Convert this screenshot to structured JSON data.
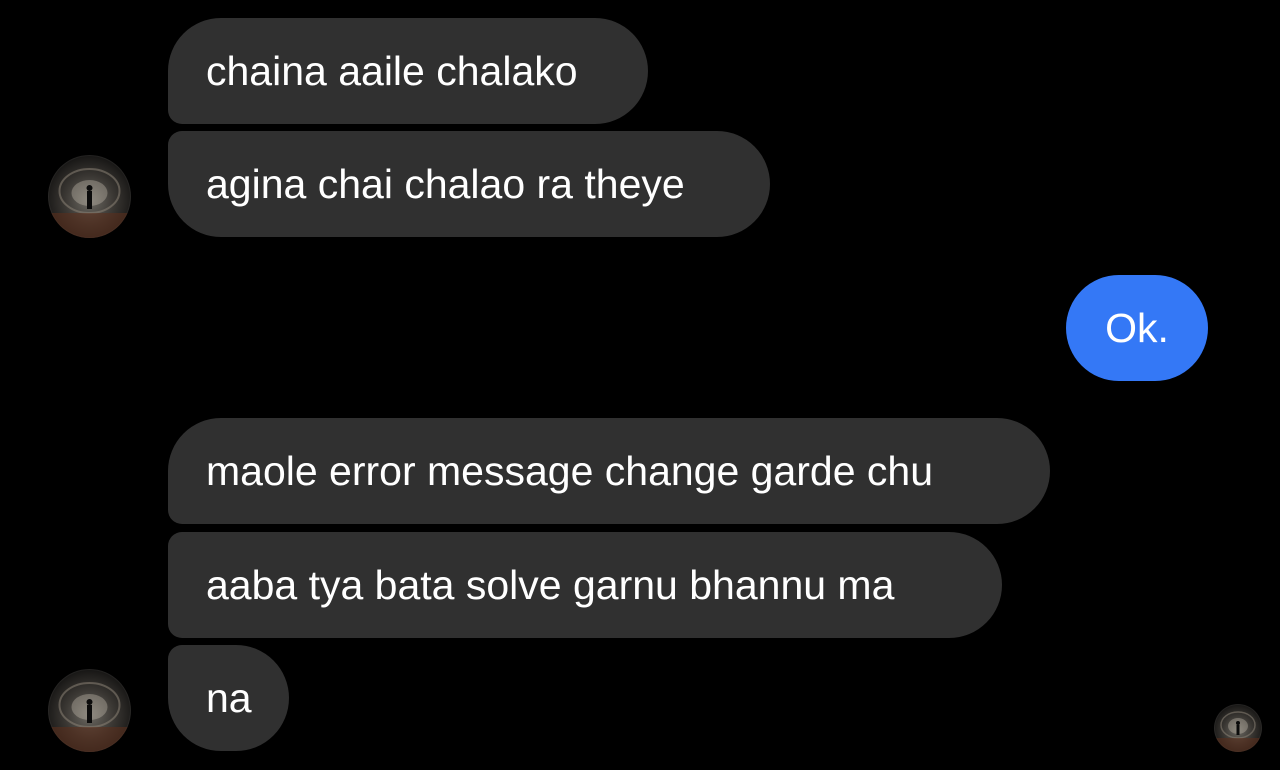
{
  "conversation": {
    "messages": [
      {
        "text": "chaina aaile chalako",
        "sender": "them"
      },
      {
        "text": "agina chai chalao ra theye",
        "sender": "them"
      },
      {
        "text": "Ok.",
        "sender": "me"
      },
      {
        "text": "maole error message change garde chu",
        "sender": "them"
      },
      {
        "text": "aaba tya bata solve garnu bhannu ma",
        "sender": "them"
      },
      {
        "text": "na",
        "sender": "them"
      }
    ]
  },
  "avatars": {
    "contact_icon": "person-in-tunnel-photo",
    "read_receipt_icon": "person-in-tunnel-photo"
  },
  "colors": {
    "background": "#000000",
    "incoming_bubble": "#303030",
    "outgoing_bubble": "#3478f6",
    "text": "#ffffff"
  }
}
